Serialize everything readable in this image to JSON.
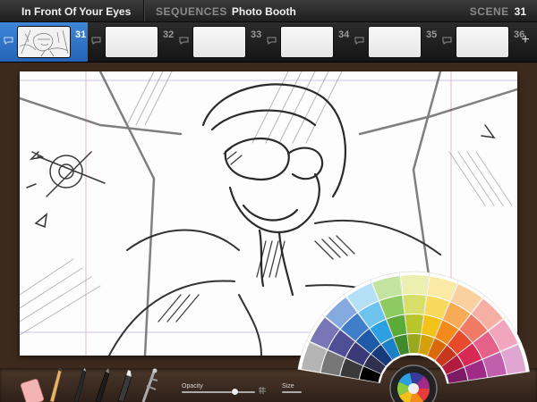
{
  "topbar": {
    "project_title": "In Front Of Your Eyes",
    "sequences_label": "SEQUENCES",
    "sequence_name": "Photo Booth",
    "scene_label": "SCENE",
    "scene_number": "31"
  },
  "filmstrip": {
    "frames": [
      {
        "number": "31",
        "selected": true
      },
      {
        "number": "32",
        "selected": false
      },
      {
        "number": "33",
        "selected": false
      },
      {
        "number": "34",
        "selected": false
      },
      {
        "number": "35",
        "selected": false
      },
      {
        "number": "36",
        "selected": false
      }
    ],
    "add_icon": "plus-icon",
    "comment_icon": "speech-bubble-icon"
  },
  "tools": {
    "opacity_label": "Opacity",
    "size_label": "Size",
    "opacity_level": 0.72,
    "items": [
      "eraser-icon",
      "pencil-icon",
      "ink-pen-icon",
      "brush-pen-icon",
      "marker-icon",
      "airbrush-icon"
    ]
  },
  "palette": {
    "accent_selected": "#2463b5",
    "swatch_columns": [
      [
        "#2f2f4f",
        "#3a3a78",
        "#4f4f98",
        "#7777b6"
      ],
      [
        "#163a7c",
        "#1e5aa8",
        "#3f7fc9",
        "#84aadf"
      ],
      [
        "#1a7fc6",
        "#2ba0e3",
        "#6cc4ef",
        "#b4e0f6"
      ],
      [
        "#3f8a2b",
        "#5bab38",
        "#8ccb5f",
        "#c2e4a0"
      ],
      [
        "#9aa820",
        "#b8c62c",
        "#d7df6a",
        "#ecefb0"
      ],
      [
        "#d4a10a",
        "#f2c21a",
        "#f8d95c",
        "#fbeaa6"
      ],
      [
        "#d96a0c",
        "#f28a1c",
        "#f7ab55",
        "#fbd0a0"
      ],
      [
        "#c8361c",
        "#e84a2c",
        "#f07a63",
        "#f6b0a3"
      ],
      [
        "#b21a3e",
        "#d62a55",
        "#e6618a",
        "#f2a6bd"
      ],
      [
        "#7e1a66",
        "#a02a88",
        "#c25fad",
        "#dea6d1"
      ]
    ],
    "gray_column": [
      "#000000",
      "#3a3a3a",
      "#777777",
      "#b4b4b4"
    ]
  }
}
